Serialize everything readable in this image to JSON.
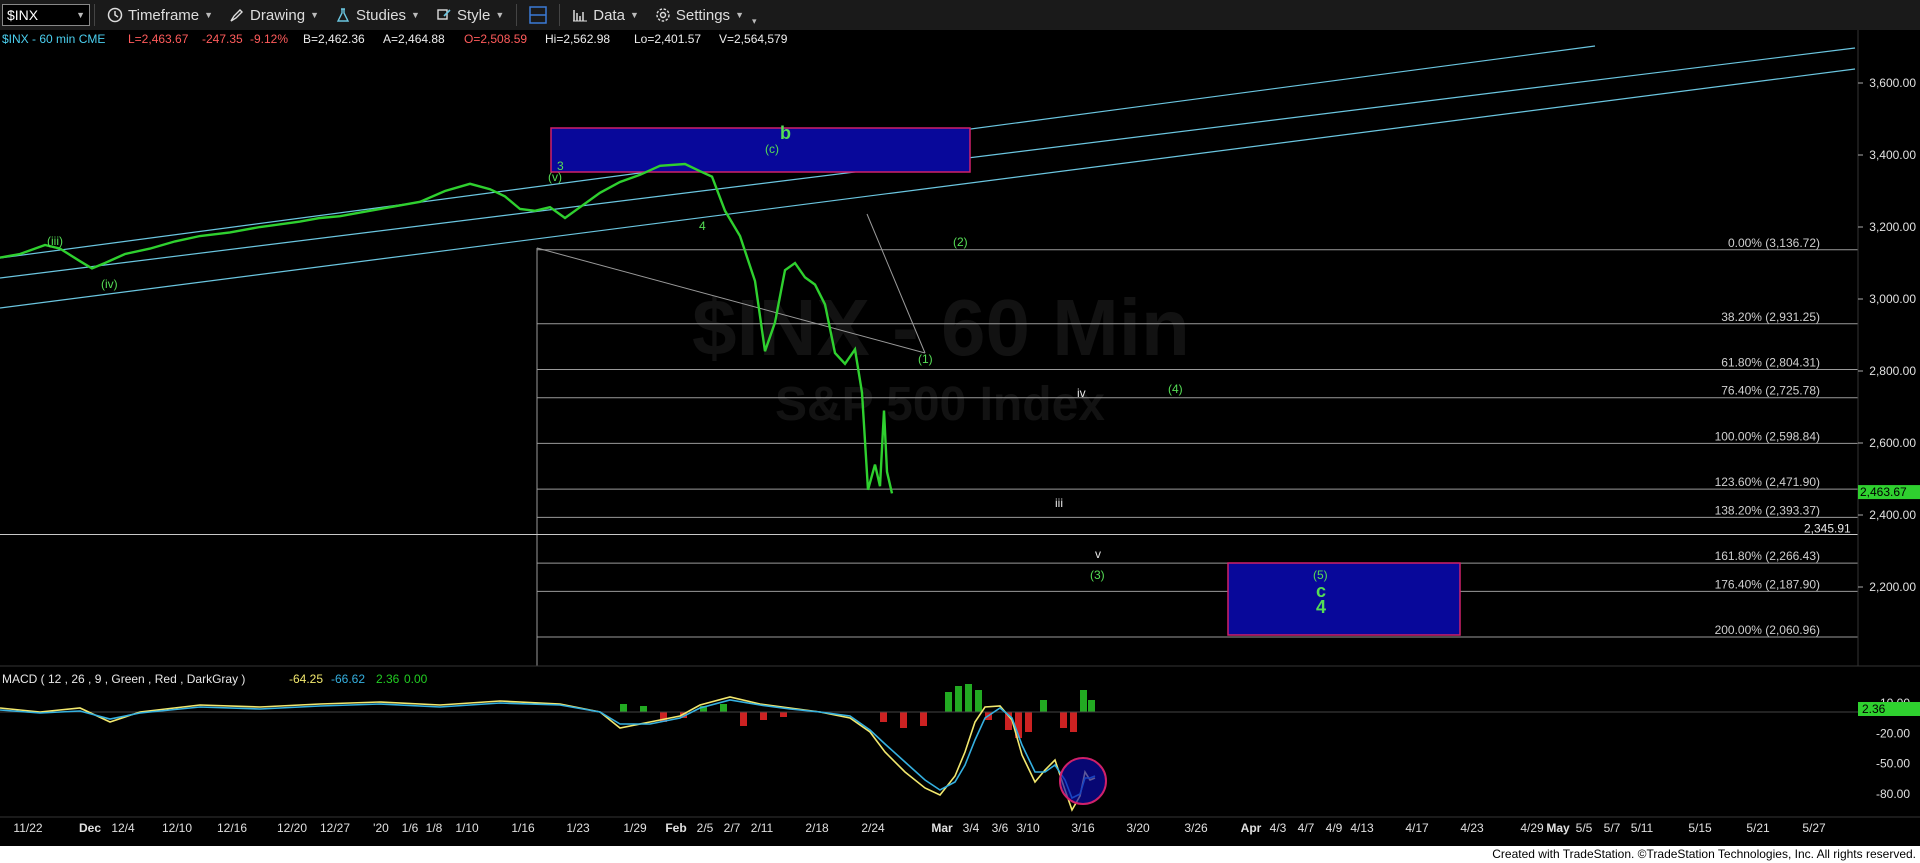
{
  "toolbar": {
    "symbol": "$INX",
    "timeframe_label": "Timeframe",
    "drawing_label": "Drawing",
    "studies_label": "Studies",
    "style_label": "Style",
    "data_label": "Data",
    "settings_label": "Settings"
  },
  "header": {
    "symbol_line": "$INX - 60 min  CME",
    "last": "L=2,463.67",
    "change": "-247.35",
    "pct": "-9.12%",
    "bid": "B=2,462.36",
    "ask": "A=2,464.88",
    "open": "O=2,508.59",
    "high": "Hi=2,562.98",
    "low": "Lo=2,401.57",
    "volume": "V=2,564,579"
  },
  "watermark": {
    "line1": "$INX - 60 Min",
    "line2": "S&P 500 Index"
  },
  "colors": {
    "price": "#2fd02f",
    "fib": "#9a9a9a",
    "channel": "#6bc6e0",
    "box_fill": "#08089a",
    "box_border": "#d0206a",
    "label_green": "#55dd55",
    "macd_line": "#f2e86e",
    "signal_line": "#35b0e0",
    "hist_up": "#22aa22",
    "hist_down": "#cc2222"
  },
  "chart_data": {
    "type": "line",
    "title": "$INX - 60 min",
    "ylim": [
      2000,
      3700
    ],
    "y_ticks": [
      "3,600.00",
      "3,400.00",
      "3,200.00",
      "3,000.00",
      "2,800.00",
      "2,600.00",
      "2,400.00",
      "2,200.00"
    ],
    "x_ticks": [
      "11/22",
      "Dec",
      "12/4",
      "12/10",
      "12/16",
      "12/20",
      "12/27",
      "'20",
      "1/6",
      "1/8",
      "1/10",
      "1/16",
      "1/23",
      "1/29",
      "Feb",
      "2/5",
      "2/7",
      "2/11",
      "2/18",
      "2/24",
      "Mar",
      "3/4",
      "3/6",
      "3/10",
      "3/16",
      "3/20",
      "3/26",
      "Apr",
      "4/3",
      "4/7",
      "4/9",
      "4/13",
      "4/17",
      "4/23",
      "4/29",
      "May",
      "5/5",
      "5/7",
      "5/11",
      "5/15",
      "5/21",
      "5/27"
    ],
    "series": [
      {
        "values": [
          [
            0,
            3115
          ],
          [
            20,
            3125
          ],
          [
            45,
            3150
          ],
          [
            60,
            3140
          ],
          [
            80,
            3105
          ],
          [
            92,
            3085
          ],
          [
            105,
            3100
          ],
          [
            125,
            3125
          ],
          [
            150,
            3140
          ],
          [
            175,
            3160
          ],
          [
            200,
            3175
          ],
          [
            230,
            3185
          ],
          [
            260,
            3200
          ],
          [
            300,
            3215
          ],
          [
            320,
            3225
          ],
          [
            340,
            3230
          ],
          [
            360,
            3240
          ],
          [
            390,
            3255
          ],
          [
            420,
            3270
          ],
          [
            445,
            3300
          ],
          [
            470,
            3320
          ],
          [
            490,
            3305
          ],
          [
            505,
            3285
          ],
          [
            520,
            3250
          ],
          [
            535,
            3245
          ],
          [
            550,
            3255
          ],
          [
            565,
            3225
          ],
          [
            575,
            3245
          ],
          [
            600,
            3295
          ],
          [
            620,
            3325
          ],
          [
            640,
            3345
          ],
          [
            660,
            3370
          ],
          [
            685,
            3375
          ],
          [
            700,
            3355
          ],
          [
            712,
            3340
          ],
          [
            725,
            3245
          ],
          [
            740,
            3175
          ],
          [
            755,
            3050
          ],
          [
            765,
            2855
          ],
          [
            775,
            2935
          ],
          [
            785,
            3080
          ],
          [
            795,
            3100
          ],
          [
            805,
            3060
          ],
          [
            815,
            3040
          ],
          [
            825,
            2985
          ],
          [
            835,
            2850
          ],
          [
            845,
            2820
          ],
          [
            855,
            2860
          ],
          [
            862,
            2740
          ],
          [
            868,
            2470
          ],
          [
            875,
            2540
          ],
          [
            880,
            2480
          ],
          [
            884,
            2690
          ],
          [
            887,
            2520
          ],
          [
            892,
            2460
          ]
        ]
      }
    ],
    "fib_levels": [
      {
        "label": "0.00% (3,136.72)",
        "value": 3136.72
      },
      {
        "label": "38.20% (2,931.25)",
        "value": 2931.25
      },
      {
        "label": "61.80% (2,804.31)",
        "value": 2804.31
      },
      {
        "label": "76.40% (2,725.78)",
        "value": 2725.78
      },
      {
        "label": "100.00% (2,598.84)",
        "value": 2598.84
      },
      {
        "label": "123.60% (2,471.90)",
        "value": 2471.9
      },
      {
        "label": "138.20% (2,393.37)",
        "value": 2393.37
      },
      {
        "label": "161.80% (2,266.43)",
        "value": 2266.43
      },
      {
        "label": "176.40% (2,187.90)",
        "value": 2187.9
      },
      {
        "label": "200.00% (2,060.96)",
        "value": 2060.96
      }
    ],
    "last_price_label": "2,463.67",
    "last_price": 2463.67,
    "horizontal_line_label": "2,345.91",
    "horizontal_line": 2345.91,
    "wave_labels": [
      "(iii)",
      "(iv)",
      "3",
      "(v)",
      "4",
      "b",
      "(c)",
      "(1)",
      "(2)",
      "iii",
      "iv",
      "v",
      "(3)",
      "(4)",
      "(5)",
      "c",
      "4"
    ]
  },
  "macd": {
    "label": "MACD ( 12 , 26 , 9 , Green , Red , DarkGray )",
    "macd_value": "-64.25",
    "signal_value": "-66.62",
    "hist_value": "2.36",
    "zero_value": "0.00",
    "y_ticks": [
      "10.00",
      "-20.00",
      "-50.00",
      "-80.00"
    ],
    "current_label": "2.36",
    "ylim": [
      -90,
      15
    ]
  },
  "footer": {
    "credit": "Created with TradeStation. ©TradeStation Technologies, Inc. All rights reserved."
  }
}
